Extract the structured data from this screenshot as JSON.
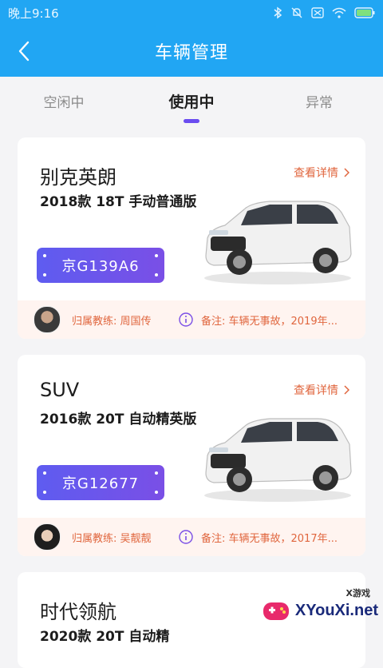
{
  "status_bar": {
    "time": "晚上9:16",
    "icons": [
      "bluetooth-icon",
      "mute-icon",
      "sim-icon",
      "wifi-icon",
      "battery-icon"
    ]
  },
  "navbar": {
    "back_icon": "chevron-left-icon",
    "title": "车辆管理"
  },
  "tabs": [
    {
      "label": "空闲中",
      "active": false
    },
    {
      "label": "使用中",
      "active": true
    },
    {
      "label": "异常",
      "active": false
    }
  ],
  "colors": {
    "primary": "#21a6f3",
    "accent": "#6a4cf0",
    "link": "#e0663e",
    "footer_bg": "#fff4f0"
  },
  "vehicles": [
    {
      "model": "别克英朗",
      "detail_label": "查看详情",
      "spec": "2018款 18T 手动普通版",
      "plate": "京G139A6",
      "coach": "归属教练: 周国传",
      "note": "备注: 车辆无事故，2019年..."
    },
    {
      "model": "SUV",
      "detail_label": "查看详情",
      "spec": "2016款 20T 自动精英版",
      "plate": "京G12677",
      "coach": "归属教练: 吴靓靓",
      "note": "备注: 车辆无事故，2017年..."
    },
    {
      "model": "时代领航",
      "spec": "2020款 20T 自动精"
    }
  ],
  "watermark": {
    "small": "X游戏",
    "main": "XYouXi.net"
  }
}
